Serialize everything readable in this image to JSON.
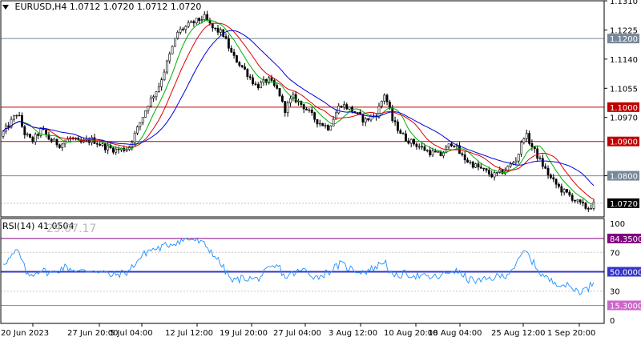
{
  "header": {
    "symbol": "EURUSD,H4",
    "open": "1.0712",
    "high": "1.0720",
    "low": "1.0712",
    "close": "1.0720"
  },
  "rsi_header": {
    "label": "RSI(14)",
    "value": "41.0504"
  },
  "watermark": "29.07.17",
  "colors": {
    "ma_fast": "#00b000",
    "ma_mid": "#e00000",
    "ma_slow": "#0000dd",
    "line_red": "#c00000",
    "line_gray": "#778899",
    "rsi_line": "#1e90ff",
    "rsi_level_high": "#800080",
    "rsi_level_mid": "#3333cc",
    "rsi_level_low": "#cc66cc"
  },
  "price_axis": {
    "ticks": [
      "1.1310",
      "1.1225",
      "1.1140",
      "1.1055",
      "1.0970",
      "1.0800"
    ],
    "range": [
      1.068,
      1.131
    ]
  },
  "price_lines": [
    {
      "price": 1.12,
      "label": "1.1200",
      "color": "#778899"
    },
    {
      "price": 1.1,
      "label": "1.1000",
      "color": "#c00000"
    },
    {
      "price": 1.09,
      "label": "1.0900",
      "color": "#c00000"
    },
    {
      "price": 1.08,
      "label": "1.0800",
      "color": "#778899"
    }
  ],
  "current_price": {
    "price": 1.072,
    "label": "1.0720"
  },
  "rsi_axis": {
    "ticks": [
      "100",
      "70",
      "30",
      "0"
    ],
    "levels": [
      {
        "value": 84.35,
        "label": "84.3500"
      },
      {
        "value": 50.0,
        "label": "50.0000"
      },
      {
        "value": 15.3,
        "label": "15.3000"
      }
    ]
  },
  "time_axis": [
    "20 Jun 2023",
    "27 Jun 20:00",
    "5 Jul 04:00",
    "12 Jul 12:00",
    "19 Jul 20:00",
    "27 Jul 04:00",
    "3 Aug 12:00",
    "10 Aug 20:00",
    "18 Aug 04:00",
    "25 Aug 12:00",
    "1 Sep 20:00"
  ],
  "chart_data": {
    "type": "candlestick",
    "symbol": "EURUSD",
    "timeframe": "H4",
    "anchors": [
      [
        0,
        1.0915
      ],
      [
        10,
        1.0945
      ],
      [
        22,
        1.0985
      ],
      [
        30,
        1.0925
      ],
      [
        40,
        1.09
      ],
      [
        52,
        1.0935
      ],
      [
        62,
        1.0905
      ],
      [
        75,
        1.089
      ],
      [
        88,
        1.091
      ],
      [
        100,
        1.0895
      ],
      [
        115,
        1.0905
      ],
      [
        130,
        1.0885
      ],
      [
        145,
        1.0875
      ],
      [
        160,
        1.088
      ],
      [
        172,
        1.094
      ],
      [
        185,
        1.101
      ],
      [
        198,
        1.106
      ],
      [
        210,
        1.114
      ],
      [
        222,
        1.122
      ],
      [
        240,
        1.1245
      ],
      [
        255,
        1.1262
      ],
      [
        265,
        1.123
      ],
      [
        278,
        1.1215
      ],
      [
        290,
        1.115
      ],
      [
        305,
        1.111
      ],
      [
        320,
        1.106
      ],
      [
        335,
        1.108
      ],
      [
        348,
        1.1045
      ],
      [
        355,
        1.099
      ],
      [
        365,
        1.103
      ],
      [
        380,
        1.1
      ],
      [
        395,
        1.096
      ],
      [
        410,
        1.094
      ],
      [
        425,
        1.101
      ],
      [
        440,
        1.099
      ],
      [
        455,
        1.096
      ],
      [
        470,
        1.098
      ],
      [
        480,
        1.104
      ],
      [
        490,
        1.096
      ],
      [
        505,
        1.091
      ],
      [
        520,
        1.089
      ],
      [
        535,
        1.087
      ],
      [
        550,
        1.086
      ],
      [
        565,
        1.09
      ],
      [
        575,
        1.086
      ],
      [
        585,
        1.084
      ],
      [
        600,
        1.082
      ],
      [
        615,
        1.08
      ],
      [
        630,
        1.0815
      ],
      [
        645,
        1.085
      ],
      [
        655,
        1.0925
      ],
      [
        665,
        1.088
      ],
      [
        675,
        1.084
      ],
      [
        688,
        1.079
      ],
      [
        700,
        1.076
      ],
      [
        712,
        1.074
      ],
      [
        722,
        1.072
      ],
      [
        733,
        1.0705
      ],
      [
        742,
        1.0718
      ]
    ],
    "rsi_anchors": [
      [
        0,
        58
      ],
      [
        10,
        62
      ],
      [
        22,
        72
      ],
      [
        35,
        45
      ],
      [
        50,
        52
      ],
      [
        65,
        48
      ],
      [
        80,
        55
      ],
      [
        100,
        50
      ],
      [
        120,
        52
      ],
      [
        140,
        46
      ],
      [
        160,
        50
      ],
      [
        172,
        62
      ],
      [
        185,
        72
      ],
      [
        198,
        74
      ],
      [
        210,
        78
      ],
      [
        225,
        82
      ],
      [
        240,
        84
      ],
      [
        255,
        78
      ],
      [
        265,
        70
      ],
      [
        278,
        55
      ],
      [
        290,
        40
      ],
      [
        305,
        44
      ],
      [
        320,
        42
      ],
      [
        335,
        52
      ],
      [
        348,
        56
      ],
      [
        355,
        44
      ],
      [
        365,
        48
      ],
      [
        380,
        52
      ],
      [
        395,
        44
      ],
      [
        410,
        50
      ],
      [
        425,
        58
      ],
      [
        440,
        52
      ],
      [
        455,
        50
      ],
      [
        470,
        55
      ],
      [
        480,
        62
      ],
      [
        490,
        44
      ],
      [
        505,
        48
      ],
      [
        520,
        46
      ],
      [
        535,
        44
      ],
      [
        550,
        45
      ],
      [
        565,
        52
      ],
      [
        575,
        48
      ],
      [
        585,
        42
      ],
      [
        600,
        40
      ],
      [
        615,
        44
      ],
      [
        630,
        46
      ],
      [
        645,
        58
      ],
      [
        655,
        72
      ],
      [
        665,
        60
      ],
      [
        675,
        48
      ],
      [
        688,
        40
      ],
      [
        700,
        38
      ],
      [
        712,
        34
      ],
      [
        722,
        30
      ],
      [
        733,
        32
      ],
      [
        742,
        41
      ]
    ]
  }
}
